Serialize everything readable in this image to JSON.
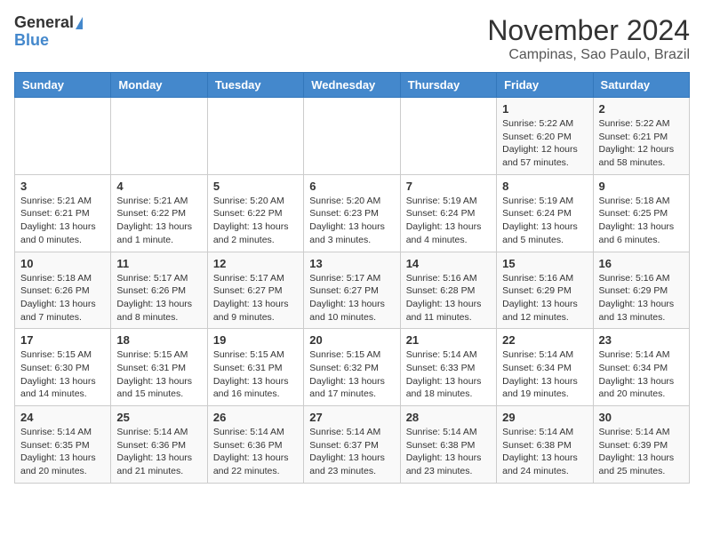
{
  "header": {
    "logo_general": "General",
    "logo_blue": "Blue",
    "title": "November 2024",
    "subtitle": "Campinas, Sao Paulo, Brazil"
  },
  "weekdays": [
    "Sunday",
    "Monday",
    "Tuesday",
    "Wednesday",
    "Thursday",
    "Friday",
    "Saturday"
  ],
  "weeks": [
    [
      {
        "day": "",
        "info": ""
      },
      {
        "day": "",
        "info": ""
      },
      {
        "day": "",
        "info": ""
      },
      {
        "day": "",
        "info": ""
      },
      {
        "day": "",
        "info": ""
      },
      {
        "day": "1",
        "info": "Sunrise: 5:22 AM\nSunset: 6:20 PM\nDaylight: 12 hours and 57 minutes."
      },
      {
        "day": "2",
        "info": "Sunrise: 5:22 AM\nSunset: 6:21 PM\nDaylight: 12 hours and 58 minutes."
      }
    ],
    [
      {
        "day": "3",
        "info": "Sunrise: 5:21 AM\nSunset: 6:21 PM\nDaylight: 13 hours and 0 minutes."
      },
      {
        "day": "4",
        "info": "Sunrise: 5:21 AM\nSunset: 6:22 PM\nDaylight: 13 hours and 1 minute."
      },
      {
        "day": "5",
        "info": "Sunrise: 5:20 AM\nSunset: 6:22 PM\nDaylight: 13 hours and 2 minutes."
      },
      {
        "day": "6",
        "info": "Sunrise: 5:20 AM\nSunset: 6:23 PM\nDaylight: 13 hours and 3 minutes."
      },
      {
        "day": "7",
        "info": "Sunrise: 5:19 AM\nSunset: 6:24 PM\nDaylight: 13 hours and 4 minutes."
      },
      {
        "day": "8",
        "info": "Sunrise: 5:19 AM\nSunset: 6:24 PM\nDaylight: 13 hours and 5 minutes."
      },
      {
        "day": "9",
        "info": "Sunrise: 5:18 AM\nSunset: 6:25 PM\nDaylight: 13 hours and 6 minutes."
      }
    ],
    [
      {
        "day": "10",
        "info": "Sunrise: 5:18 AM\nSunset: 6:26 PM\nDaylight: 13 hours and 7 minutes."
      },
      {
        "day": "11",
        "info": "Sunrise: 5:17 AM\nSunset: 6:26 PM\nDaylight: 13 hours and 8 minutes."
      },
      {
        "day": "12",
        "info": "Sunrise: 5:17 AM\nSunset: 6:27 PM\nDaylight: 13 hours and 9 minutes."
      },
      {
        "day": "13",
        "info": "Sunrise: 5:17 AM\nSunset: 6:27 PM\nDaylight: 13 hours and 10 minutes."
      },
      {
        "day": "14",
        "info": "Sunrise: 5:16 AM\nSunset: 6:28 PM\nDaylight: 13 hours and 11 minutes."
      },
      {
        "day": "15",
        "info": "Sunrise: 5:16 AM\nSunset: 6:29 PM\nDaylight: 13 hours and 12 minutes."
      },
      {
        "day": "16",
        "info": "Sunrise: 5:16 AM\nSunset: 6:29 PM\nDaylight: 13 hours and 13 minutes."
      }
    ],
    [
      {
        "day": "17",
        "info": "Sunrise: 5:15 AM\nSunset: 6:30 PM\nDaylight: 13 hours and 14 minutes."
      },
      {
        "day": "18",
        "info": "Sunrise: 5:15 AM\nSunset: 6:31 PM\nDaylight: 13 hours and 15 minutes."
      },
      {
        "day": "19",
        "info": "Sunrise: 5:15 AM\nSunset: 6:31 PM\nDaylight: 13 hours and 16 minutes."
      },
      {
        "day": "20",
        "info": "Sunrise: 5:15 AM\nSunset: 6:32 PM\nDaylight: 13 hours and 17 minutes."
      },
      {
        "day": "21",
        "info": "Sunrise: 5:14 AM\nSunset: 6:33 PM\nDaylight: 13 hours and 18 minutes."
      },
      {
        "day": "22",
        "info": "Sunrise: 5:14 AM\nSunset: 6:34 PM\nDaylight: 13 hours and 19 minutes."
      },
      {
        "day": "23",
        "info": "Sunrise: 5:14 AM\nSunset: 6:34 PM\nDaylight: 13 hours and 20 minutes."
      }
    ],
    [
      {
        "day": "24",
        "info": "Sunrise: 5:14 AM\nSunset: 6:35 PM\nDaylight: 13 hours and 20 minutes."
      },
      {
        "day": "25",
        "info": "Sunrise: 5:14 AM\nSunset: 6:36 PM\nDaylight: 13 hours and 21 minutes."
      },
      {
        "day": "26",
        "info": "Sunrise: 5:14 AM\nSunset: 6:36 PM\nDaylight: 13 hours and 22 minutes."
      },
      {
        "day": "27",
        "info": "Sunrise: 5:14 AM\nSunset: 6:37 PM\nDaylight: 13 hours and 23 minutes."
      },
      {
        "day": "28",
        "info": "Sunrise: 5:14 AM\nSunset: 6:38 PM\nDaylight: 13 hours and 23 minutes."
      },
      {
        "day": "29",
        "info": "Sunrise: 5:14 AM\nSunset: 6:38 PM\nDaylight: 13 hours and 24 minutes."
      },
      {
        "day": "30",
        "info": "Sunrise: 5:14 AM\nSunset: 6:39 PM\nDaylight: 13 hours and 25 minutes."
      }
    ]
  ]
}
